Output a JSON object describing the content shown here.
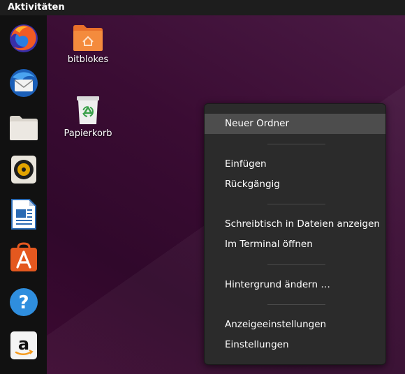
{
  "topbar": {
    "activities": "Aktivitäten"
  },
  "dock": {
    "items": [
      {
        "name": "Firefox",
        "icon": "firefox-icon"
      },
      {
        "name": "Thunderbird",
        "icon": "thunderbird-icon"
      },
      {
        "name": "Dateien",
        "icon": "files-icon"
      },
      {
        "name": "Rhythmbox",
        "icon": "rhythmbox-icon"
      },
      {
        "name": "LibreOffice Writer",
        "icon": "writer-icon"
      },
      {
        "name": "Ubuntu Software",
        "icon": "software-icon"
      },
      {
        "name": "Hilfe",
        "icon": "help-icon"
      },
      {
        "name": "Amazon",
        "icon": "amazon-icon"
      }
    ],
    "help_glyph": "?",
    "amazon_glyph": "a"
  },
  "desktop": {
    "icons": [
      {
        "label": "bitblokes",
        "icon": "home-folder-icon"
      },
      {
        "label": "Papierkorb",
        "icon": "trash-icon"
      }
    ]
  },
  "context_menu": {
    "items": [
      {
        "label": "Neuer Ordner",
        "highlighted": true
      },
      {
        "label": "Einfügen"
      },
      {
        "label": "Rückgängig"
      },
      {
        "label": "Schreibtisch in Dateien anzeigen"
      },
      {
        "label": "Im Terminal öffnen"
      },
      {
        "label": "Hintergrund ändern …"
      },
      {
        "label": "Anzeigeeinstellungen"
      },
      {
        "label": "Einstellungen"
      }
    ]
  },
  "colors": {
    "desktop": "#3a0c33",
    "dock": "#111111",
    "menu_bg": "#2b2b2b",
    "menu_highlight": "#4d4d4d",
    "folder_orange": "#f48b3d"
  }
}
